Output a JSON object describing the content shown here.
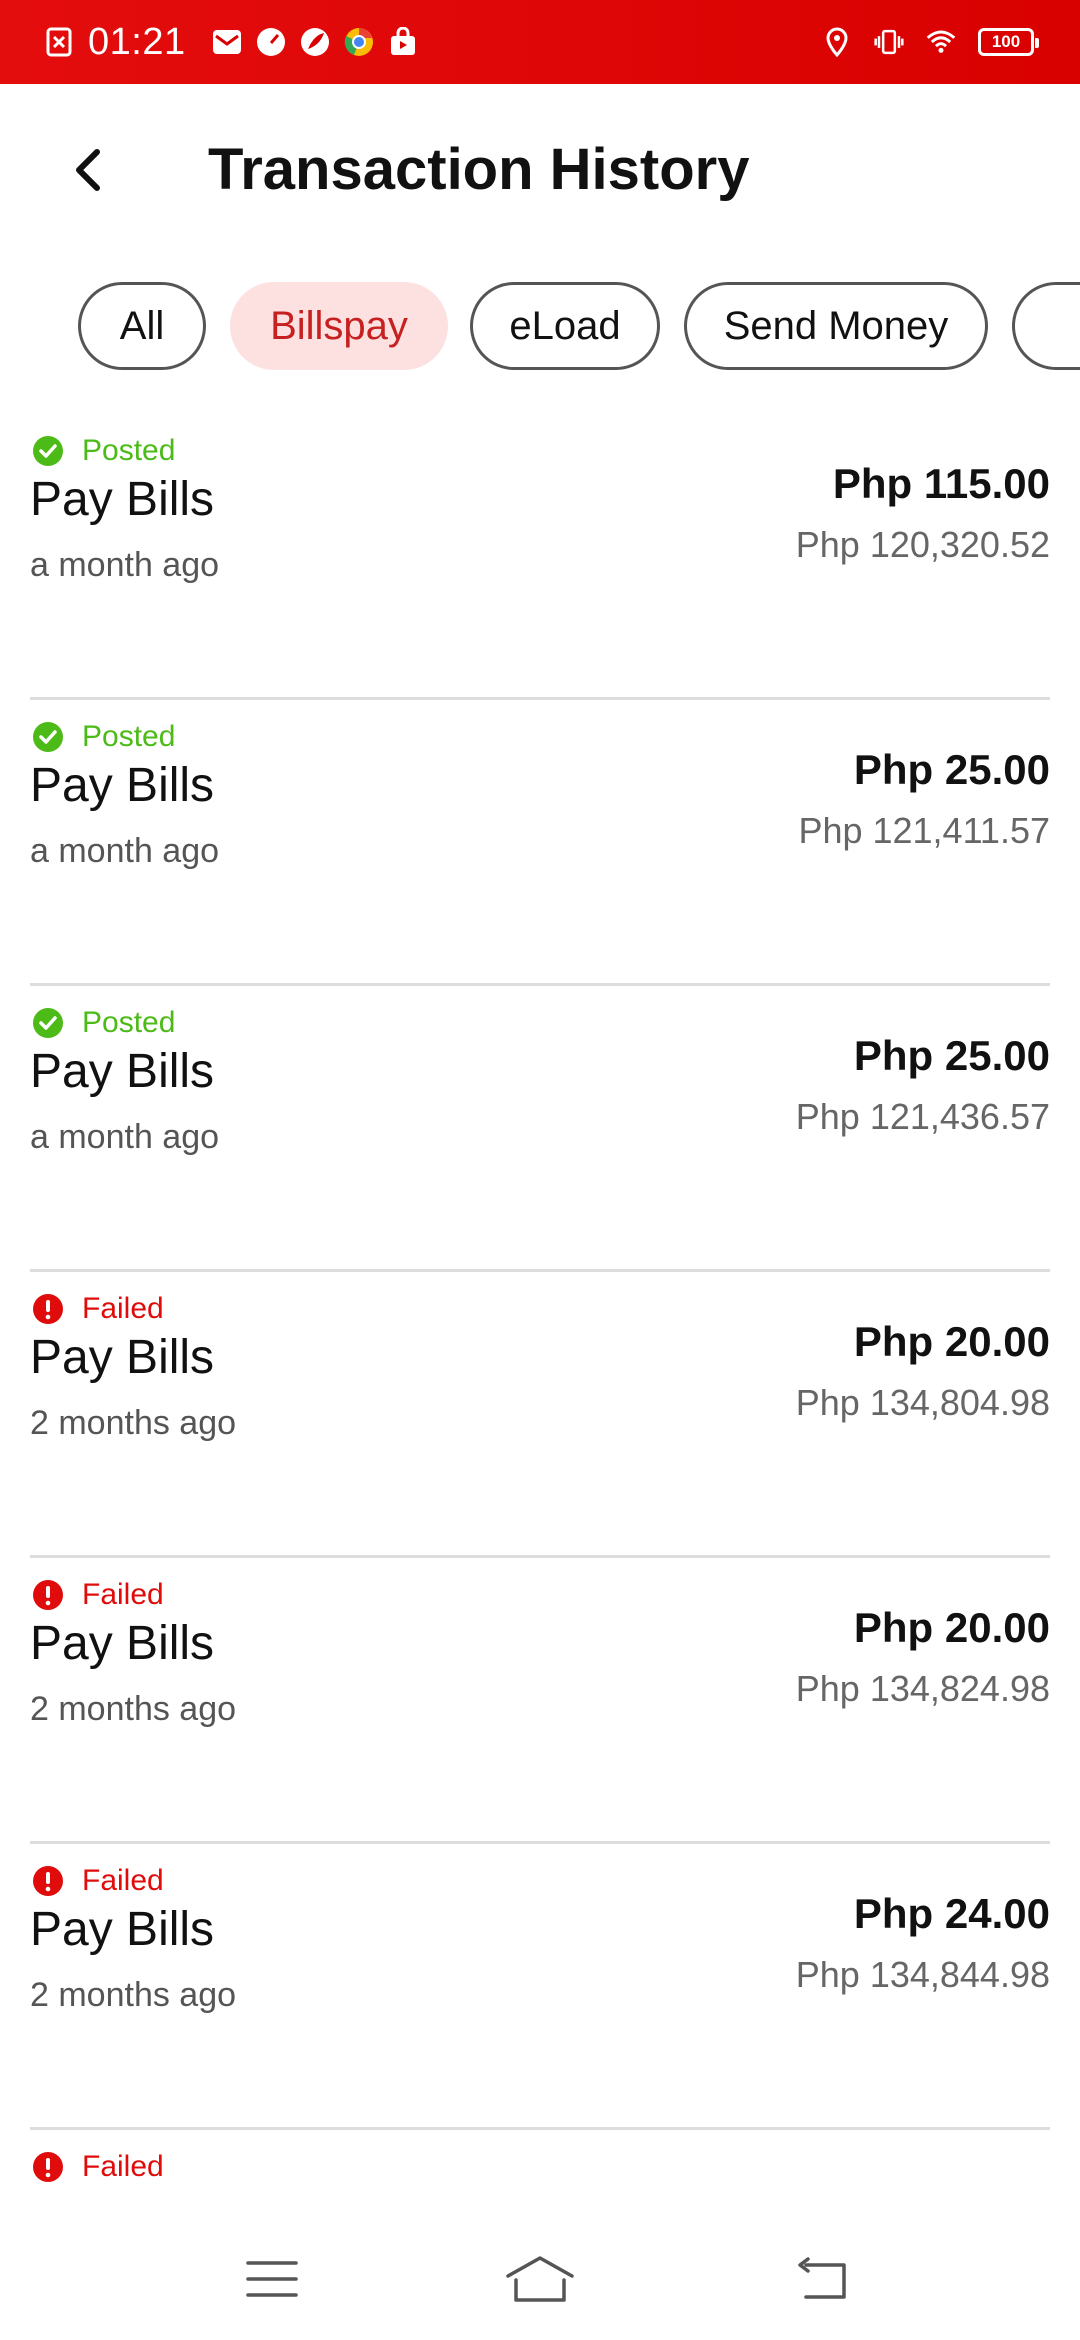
{
  "status_bar": {
    "time": "01:21",
    "battery": "100",
    "icons_left": [
      "close-box-icon",
      "mail-icon",
      "speedometer-icon",
      "leaf-icon",
      "chrome-icon",
      "shopping-bag-icon"
    ],
    "icons_right": [
      "location-icon",
      "vibrate-icon",
      "wifi-icon",
      "battery-icon"
    ]
  },
  "header": {
    "title": "Transaction History"
  },
  "filters": [
    {
      "label": "All",
      "active": false
    },
    {
      "label": "Billspay",
      "active": true
    },
    {
      "label": "eLoad",
      "active": false
    },
    {
      "label": "Send Money",
      "active": false
    }
  ],
  "transactions": [
    {
      "status": "Posted",
      "title": "Pay Bills",
      "time": "a month ago",
      "amount": "Php 115.00",
      "balance": "Php 120,320.52"
    },
    {
      "status": "Posted",
      "title": "Pay Bills",
      "time": "a month ago",
      "amount": "Php 25.00",
      "balance": "Php 121,411.57"
    },
    {
      "status": "Posted",
      "title": "Pay Bills",
      "time": "a month ago",
      "amount": "Php 25.00",
      "balance": "Php 121,436.57"
    },
    {
      "status": "Failed",
      "title": "Pay Bills",
      "time": "2 months ago",
      "amount": "Php 20.00",
      "balance": "Php 134,804.98"
    },
    {
      "status": "Failed",
      "title": "Pay Bills",
      "time": "2 months ago",
      "amount": "Php 20.00",
      "balance": "Php 134,824.98"
    },
    {
      "status": "Failed",
      "title": "Pay Bills",
      "time": "2 months ago",
      "amount": "Php 24.00",
      "balance": "Php 134,844.98"
    },
    {
      "status": "Failed"
    }
  ],
  "colors": {
    "status_bar": "#e00b0b",
    "posted": "#4cbb17",
    "failed": "#e00b0b",
    "active_chip_bg": "#fde1e1",
    "active_chip_text": "#c62020"
  }
}
